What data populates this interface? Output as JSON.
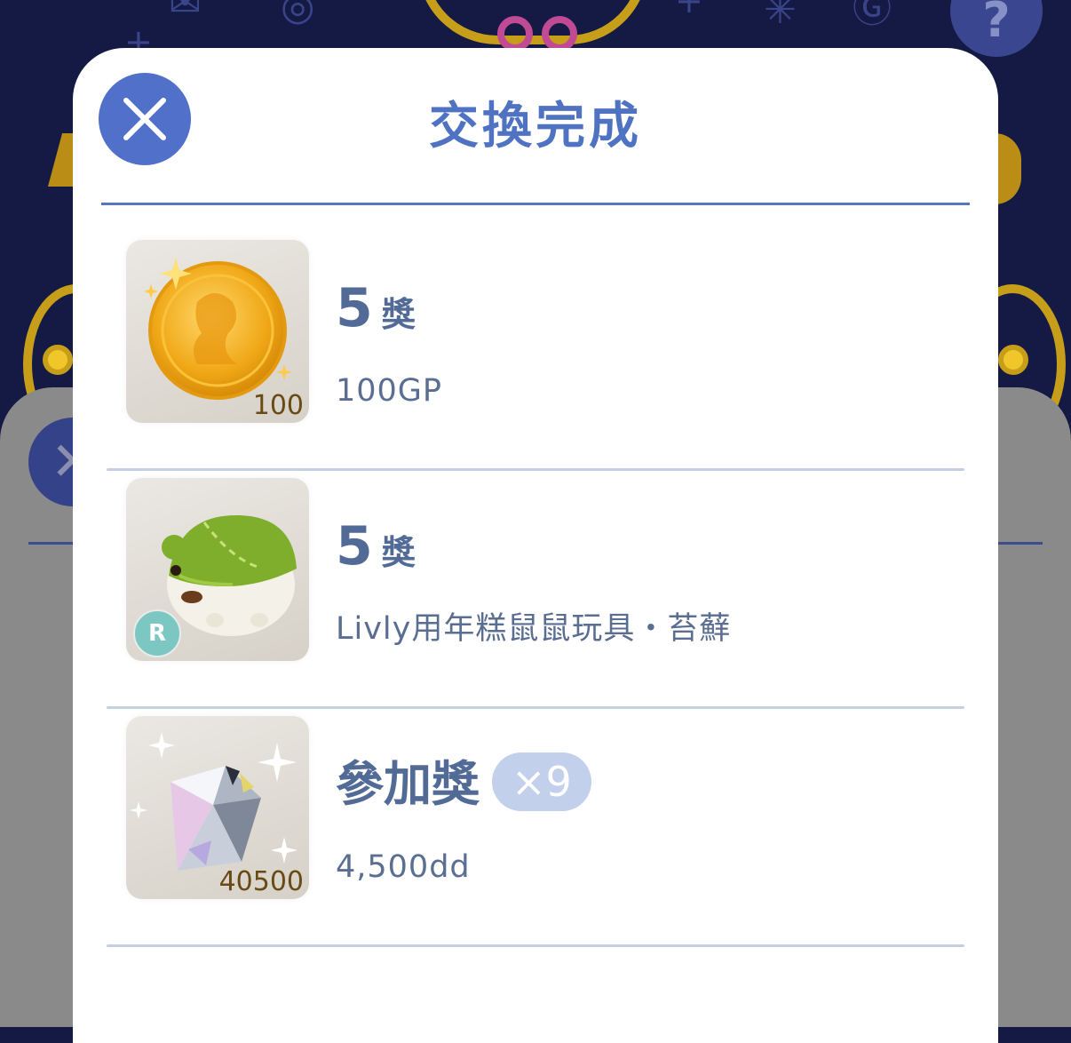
{
  "dialog": {
    "title": "交換完成",
    "close_icon": "close-icon"
  },
  "prizes": [
    {
      "rank_number": "5",
      "rank_unit": "獎",
      "name": "100GP",
      "image": "gold-coin-icon",
      "thumb_count": "100",
      "badge": ""
    },
    {
      "rank_number": "5",
      "rank_unit": "獎",
      "name": "Livly用年糕鼠鼠玩具・苔蘚",
      "image": "moss-mouse-toy-icon",
      "thumb_count": "",
      "badge": "R"
    },
    {
      "rank_label": "參加獎",
      "multiplier": "×9",
      "name": "4,500dd",
      "image": "diamond-icon",
      "thumb_count": "40500"
    }
  ],
  "colors": {
    "accent": "#5170c9",
    "title": "#4f72c2",
    "text": "#526a96",
    "background": "#141a44"
  }
}
